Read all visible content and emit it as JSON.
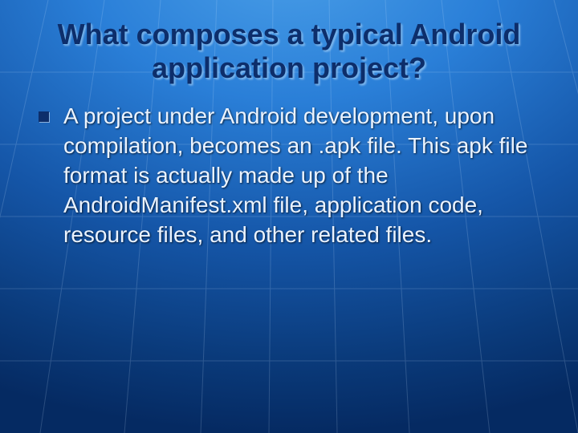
{
  "slide": {
    "title": "What composes a typical Android application project?",
    "bullets": [
      {
        "text": "A project under Android development, upon compilation, becomes an .apk file. This apk file format is actually made up of the AndroidManifest.xml file, application code, resource files, and other related files."
      }
    ]
  }
}
